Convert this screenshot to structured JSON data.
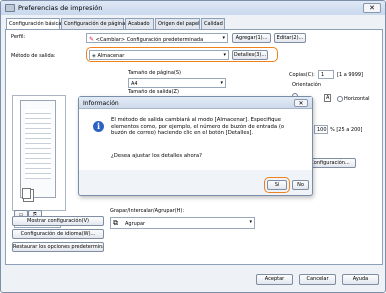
{
  "window": {
    "title": "Preferencias de impresión",
    "close": "✕"
  },
  "tabs": [
    "Configuración básica",
    "Configuración de página",
    "Acabado",
    "Origen del papel",
    "Calidad"
  ],
  "profile": {
    "label": "Perfil:",
    "value": "<Cambiar> Configuración predeterminada",
    "add": "Agregar(1)...",
    "edit": "Editar(2)..."
  },
  "output": {
    "label": "Método de salida:",
    "value": "Almacenar",
    "details": "Detalles(3)..."
  },
  "page_size": {
    "label": "Tamaño de página(S)",
    "value": "A4"
  },
  "output_size": {
    "label": "Tamaño de salida(Z)"
  },
  "copies": {
    "label": "Copias(C):",
    "value": "1",
    "range": "[1 a 9999]"
  },
  "orientation": {
    "label": "Orientación",
    "vertical_letter": "A",
    "horizontal": "Horizontal"
  },
  "zoom": {
    "value": "100",
    "range": "% [25 a 200]"
  },
  "preview": {
    "caption": "A4 [Escala: Auto]"
  },
  "settings_btn": "Configuración...",
  "group": {
    "label": "Grapar/Intercalar/Agrupar(H):",
    "value": "Agrupar"
  },
  "left_buttons": [
    "Mostrar configuración(V)",
    "Configuración de idioma(W)...",
    "Restaurar los opciones predeterminadas"
  ],
  "footer": {
    "ok": "Aceptar",
    "cancel": "Cancelar",
    "help": "Ayuda"
  },
  "dialog": {
    "title": "Información",
    "close": "✕",
    "icon": "i",
    "message": "El método de salida cambiará al modo [Almacenar]. Especifique elementos como, por ejemplo, el número de buzón de entrada (o buzón de correo) haciendo clic en el botón [Detalles].",
    "question": "¿Desea ajustar los detalles ahora?",
    "yes": "Sí",
    "no": "No"
  },
  "colors": {
    "highlight": "#f0821e",
    "accent": "#2b62c4"
  }
}
